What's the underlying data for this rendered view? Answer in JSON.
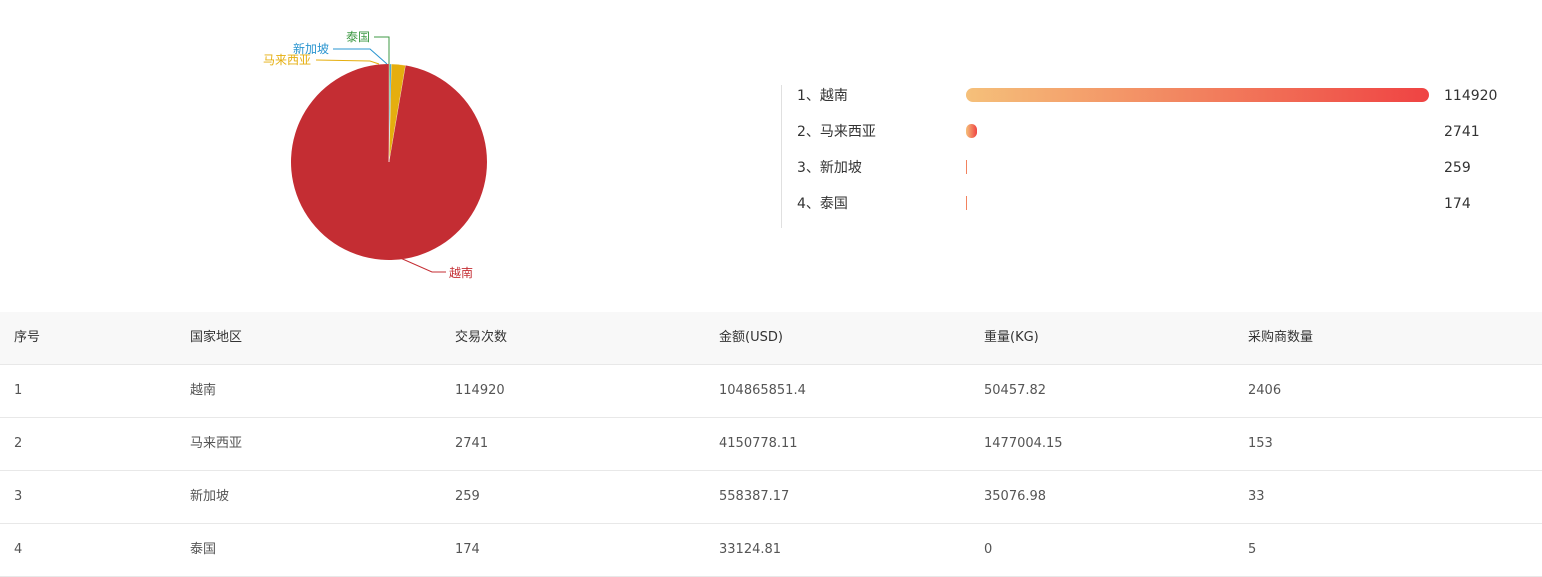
{
  "chart_data": [
    {
      "type": "pie",
      "slices": [
        {
          "label": "越南",
          "value": 114920,
          "color": "#c42d33"
        },
        {
          "label": "马来西亚",
          "value": 2741,
          "color": "#e5ae0e"
        },
        {
          "label": "新加坡",
          "value": 259,
          "color": "#2a95d0"
        },
        {
          "label": "泰国",
          "value": 174,
          "color": "#3f9a45"
        }
      ]
    },
    {
      "type": "bar",
      "orientation": "horizontal",
      "categories": [
        "1、越南",
        "2、马来西亚",
        "3、新加坡",
        "4、泰国"
      ],
      "values": [
        114920,
        2741,
        259,
        174
      ],
      "value_labels": [
        "114920",
        "2741",
        "259",
        "174"
      ],
      "bar_gradient": [
        "#f5c07a",
        "#ef4343"
      ]
    }
  ],
  "table": {
    "headers": [
      "序号",
      "国家地区",
      "交易次数",
      "金额(USD)",
      "重量(KG)",
      "采购商数量"
    ],
    "rows": [
      [
        "1",
        "越南",
        "114920",
        "104865851.4",
        "50457.82",
        "2406"
      ],
      [
        "2",
        "马来西亚",
        "2741",
        "4150778.11",
        "1477004.15",
        "153"
      ],
      [
        "3",
        "新加坡",
        "259",
        "558387.17",
        "35076.98",
        "33"
      ],
      [
        "4",
        "泰国",
        "174",
        "33124.81",
        "0",
        "5"
      ]
    ]
  }
}
